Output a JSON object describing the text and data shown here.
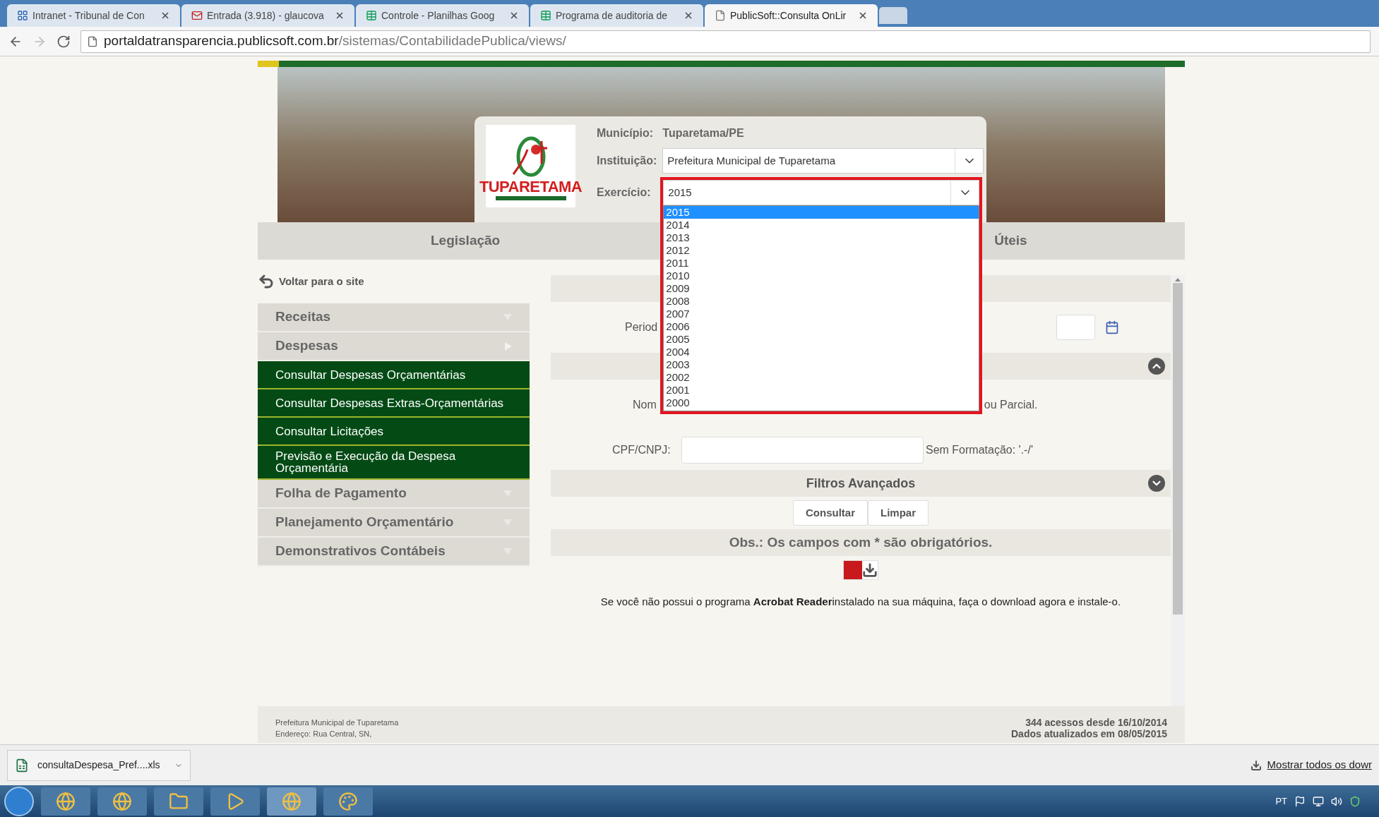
{
  "browser": {
    "tabs": [
      {
        "title": "Intranet - Tribunal de Con",
        "selected": false
      },
      {
        "title": "Entrada (3.918) - glaucova",
        "selected": false
      },
      {
        "title": "Controle - Planilhas Goog",
        "selected": false
      },
      {
        "title": "Programa de auditoria de",
        "selected": false
      },
      {
        "title": "PublicSoft::Consulta OnLir",
        "selected": true
      }
    ],
    "address": {
      "host": "portaldatransparencia.publicsoft.com.br",
      "path": "/sistemas/ContabilidadePublica/views/"
    }
  },
  "header": {
    "logo_text": "TUPARETAMA",
    "municipio": {
      "label": "Município:",
      "value": "Tuparetama/PE"
    },
    "instituicao": {
      "label": "Instituição:",
      "value": "Prefeitura Municipal de Tuparetama"
    },
    "exercicio": {
      "label": "Exercício:",
      "value": "2015",
      "options": [
        {
          "label": "2015",
          "selected": true
        },
        {
          "label": "2014",
          "selected": false
        },
        {
          "label": "2013",
          "selected": false
        },
        {
          "label": "2012",
          "selected": false
        },
        {
          "label": "2011",
          "selected": false
        },
        {
          "label": "2010",
          "selected": false
        },
        {
          "label": "2009",
          "selected": false
        },
        {
          "label": "2008",
          "selected": false
        },
        {
          "label": "2007",
          "selected": false
        },
        {
          "label": "2006",
          "selected": false
        },
        {
          "label": "2005",
          "selected": false
        },
        {
          "label": "2004",
          "selected": false
        },
        {
          "label": "2003",
          "selected": false
        },
        {
          "label": "2002",
          "selected": false
        },
        {
          "label": "2001",
          "selected": false
        },
        {
          "label": "2000",
          "selected": false
        }
      ]
    }
  },
  "nav": [
    "Legislação",
    "Úteis"
  ],
  "sidebar": {
    "back_link": "Voltar para o site",
    "menu": [
      {
        "label": "Receitas",
        "kind": "section",
        "expanded": false
      },
      {
        "label": "Despesas",
        "kind": "section",
        "expanded": true
      },
      {
        "label": "Consultar Despesas Orçamentárias",
        "kind": "item"
      },
      {
        "label": "Consultar Despesas Extras-Orçamentárias",
        "kind": "item"
      },
      {
        "label": "Consultar Licitações",
        "kind": "item"
      },
      {
        "label": "Previsão e Execução da Despesa Orçamentária",
        "kind": "item"
      },
      {
        "label": "Folha de Pagamento",
        "kind": "section",
        "expanded": false
      },
      {
        "label": "Planejamento Orçamentário",
        "kind": "section",
        "expanded": false
      },
      {
        "label": "Demonstrativos Contábeis",
        "kind": "section",
        "expanded": false
      }
    ]
  },
  "form": {
    "period_label": "Period",
    "name_label": "Nom",
    "name_hint": "ou Parcial.",
    "cpf_label": "CPF/CNPJ:",
    "cpf_hint": "Sem Formatação: '.-/'",
    "advanced": "Filtros Avançados",
    "buttons": [
      "Consultar",
      "Limpar"
    ],
    "obs": "Obs.: Os campos com * são obrigatórios.",
    "acrobat_note": "Se você não possui o programa **Acrobat Reader**instalado na sua máquina, faça o download agora e instale-o."
  },
  "footer": {
    "left": [
      "Prefeitura Municipal de Tuparetama",
      "Endereço: Rua Central, SN,"
    ],
    "right": [
      "344 acessos desde 16/10/2014",
      "Dados atualizados em 08/05/2015"
    ]
  },
  "downloads": {
    "file": "consultaDespesa_Pref....xls",
    "show_all": "Mostrar todos os dowr"
  },
  "taskbar": {
    "language": "PT"
  }
}
